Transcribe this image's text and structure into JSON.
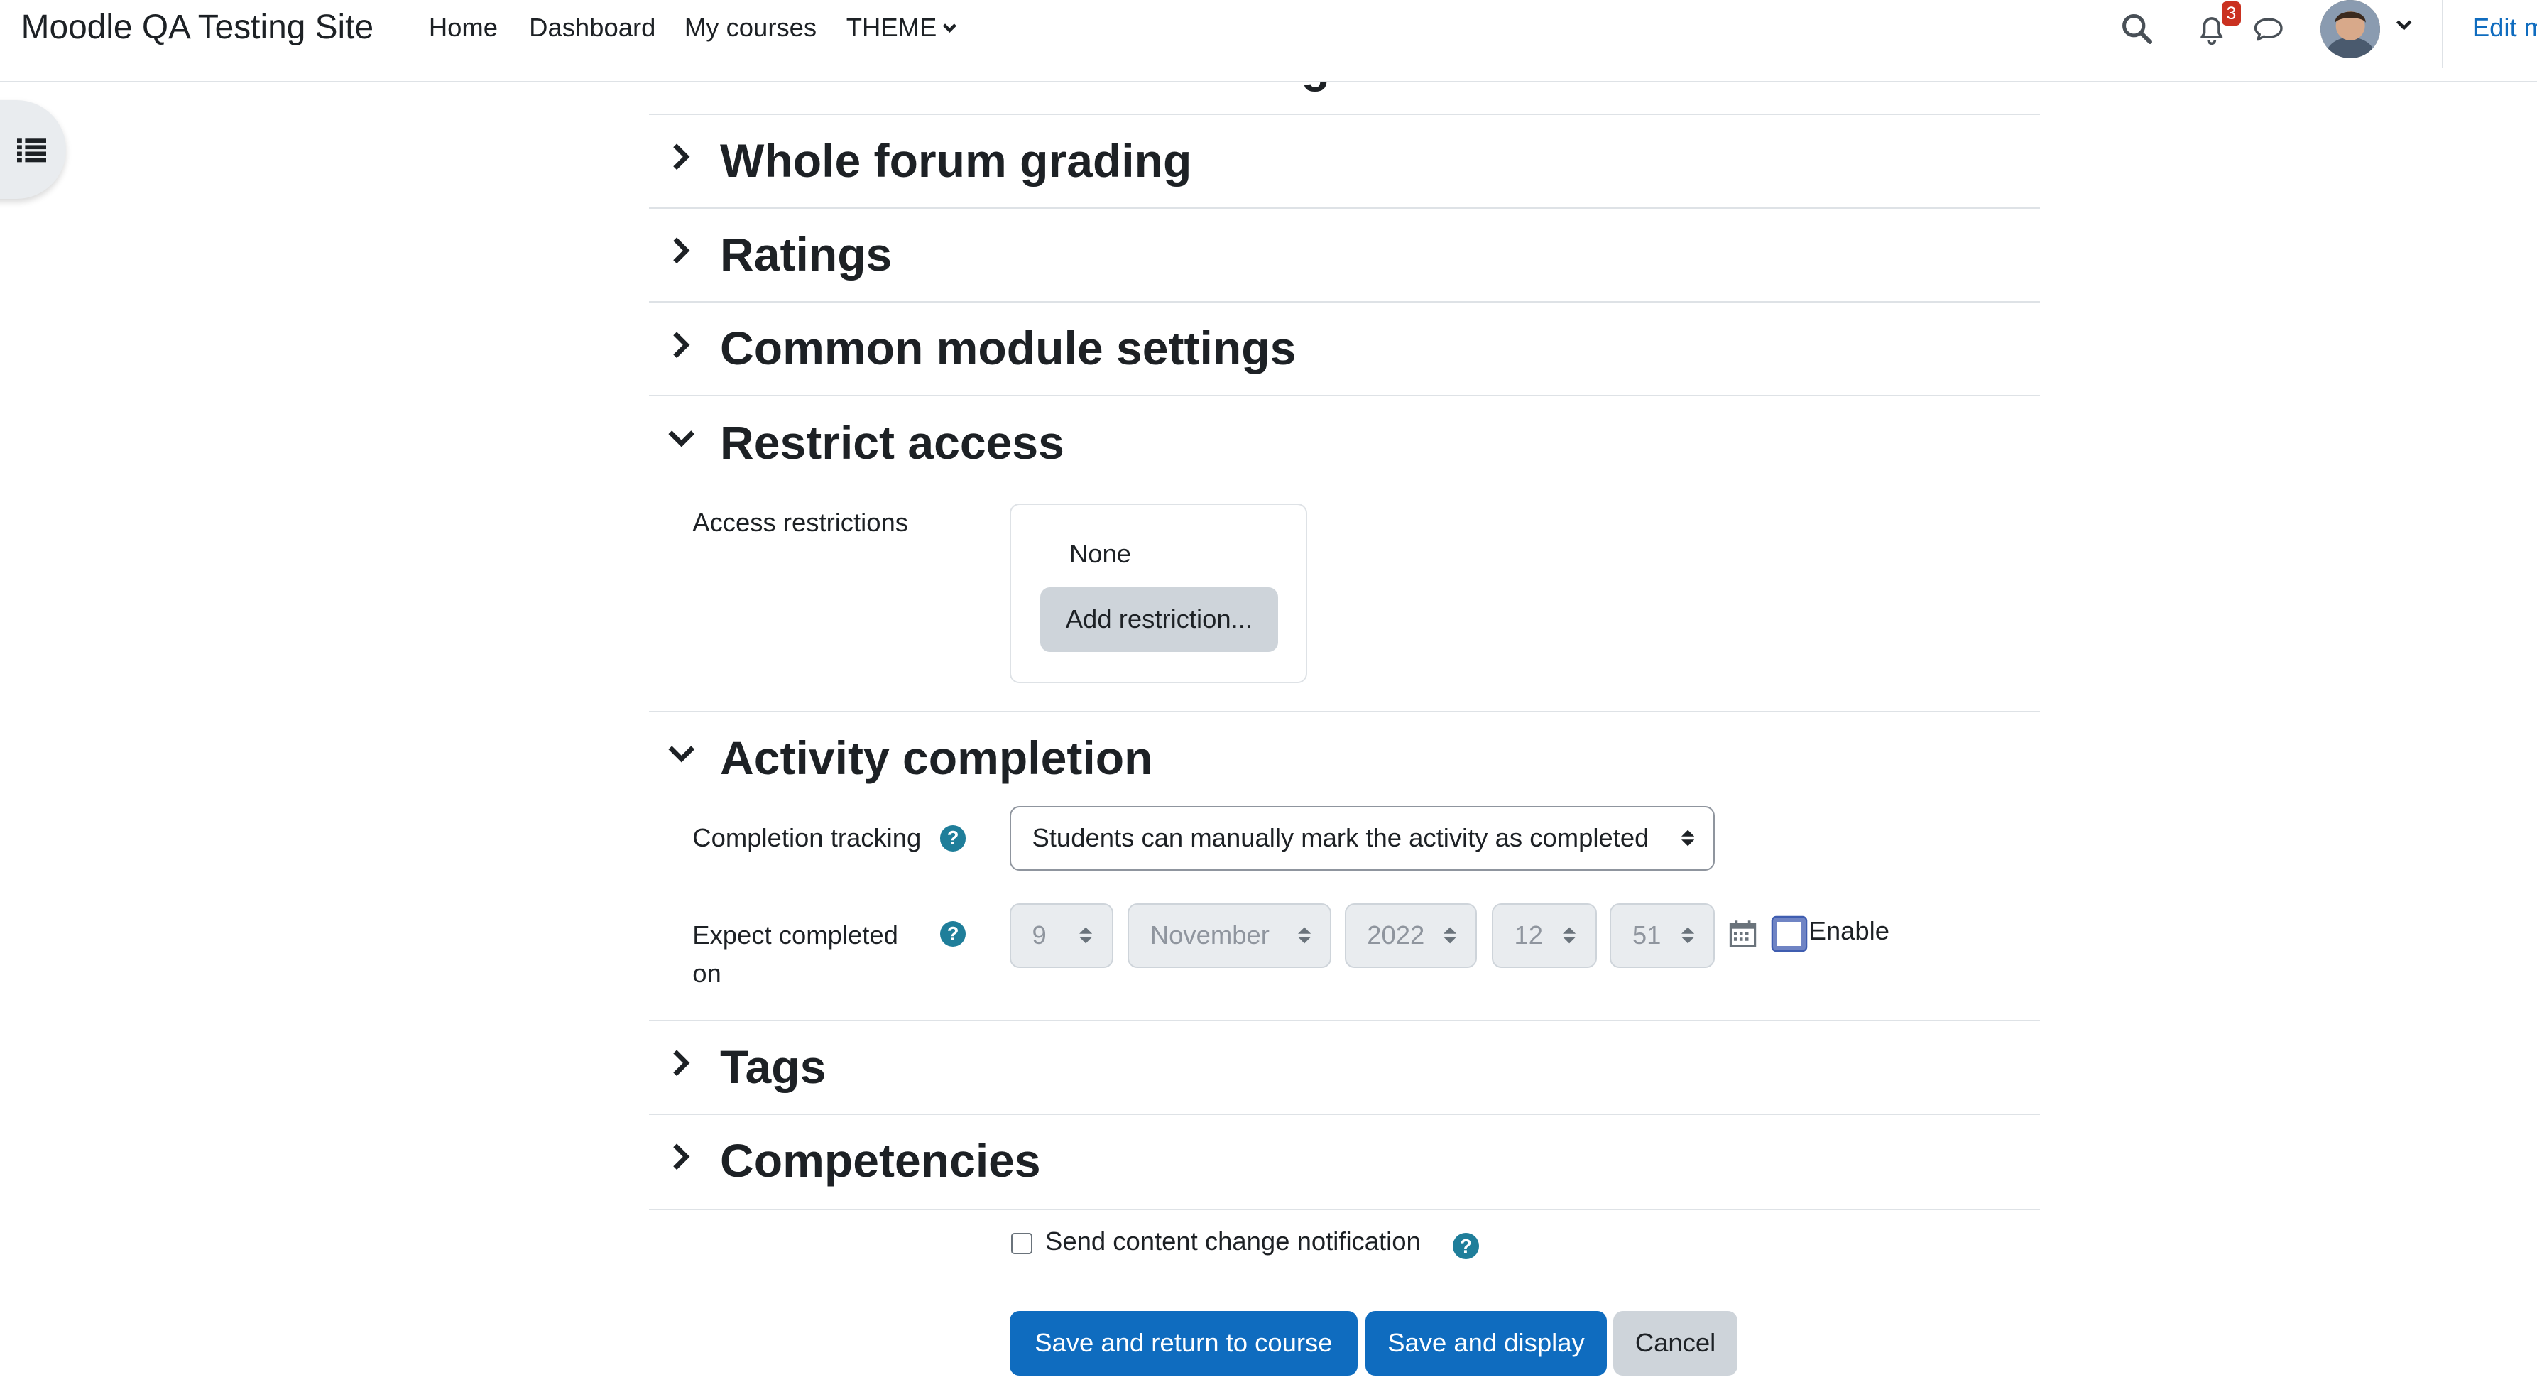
{
  "navbar": {
    "site_title": "Moodle QA Testing Site",
    "links": [
      "Home",
      "Dashboard",
      "My courses",
      "THEME"
    ],
    "notification_count": "3",
    "edit_mode_label": "Edit m"
  },
  "sections": {
    "partial_above": "Post threshold for blocking",
    "whole_forum_grading": "Whole forum grading",
    "ratings": "Ratings",
    "common_module_settings": "Common module settings",
    "restrict_access": "Restrict access",
    "activity_completion": "Activity completion",
    "tags": "Tags",
    "competencies": "Competencies"
  },
  "restrict": {
    "label": "Access restrictions",
    "none": "None",
    "add_button": "Add restriction..."
  },
  "completion": {
    "tracking_label": "Completion tracking",
    "tracking_value": "Students can manually mark the activity as completed",
    "expect_label": "Expect completed on",
    "day": "9",
    "month": "November",
    "year": "2022",
    "hour": "12",
    "minute": "51",
    "enable_label": "Enable",
    "enable_checked": false
  },
  "notify": {
    "label": "Send content change notification",
    "checked": false
  },
  "buttons": {
    "save_return": "Save and return to course",
    "save_display": "Save and display",
    "cancel": "Cancel"
  },
  "icons": {
    "drawer": "list-icon",
    "search": "search-icon",
    "notifications": "bell-icon",
    "messages": "chat-icon",
    "calendar": "calendar-icon",
    "help": "question-circle-icon"
  },
  "colors": {
    "primary": "#0f6cbf",
    "secondary": "#ced4da",
    "help": "#1f7e9a",
    "badge": "#ca3120"
  }
}
